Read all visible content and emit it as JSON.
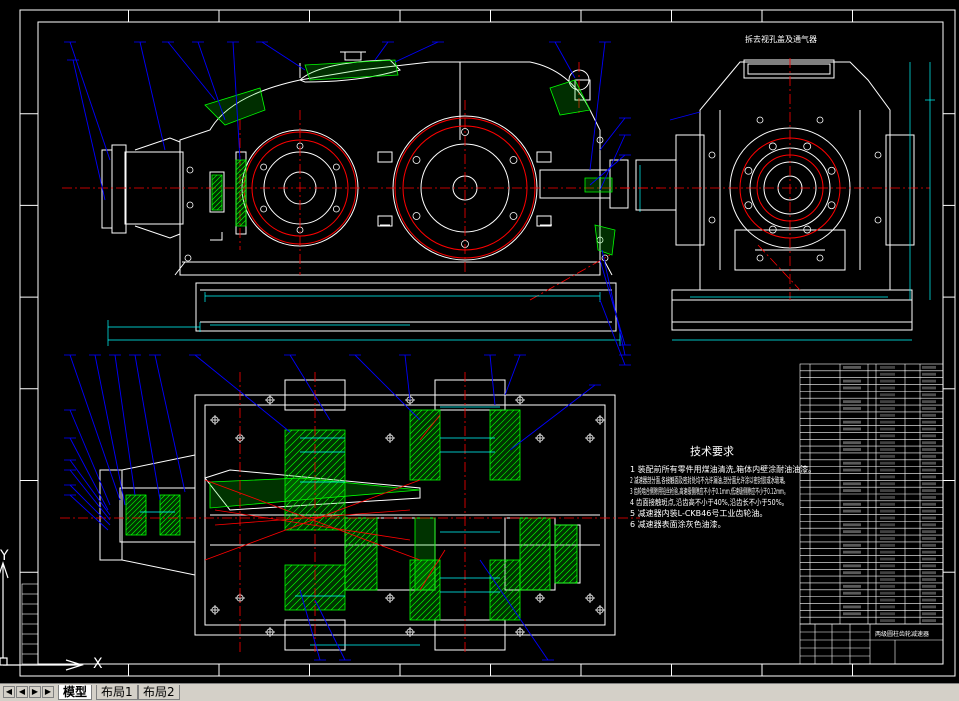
{
  "workspace": {
    "background": "#000000",
    "colors": {
      "frame": "#ffffff",
      "outline": "#ffffff",
      "center": "#ff0000",
      "gear": "#ff0000",
      "dimension": "#00ffff",
      "leader": "#0000ff",
      "hatch": "#00ff00",
      "text": "#ffffff",
      "label": "#ffff00"
    }
  },
  "view_titles": {
    "side_view": "拆去视孔盖及通气器"
  },
  "tech_req": {
    "title": "技术要求",
    "items": [
      "1  装配前所有零件用煤油清洗,箱体内壁涂耐油油漆。",
      "2  减速器剖分面,各接触面及密封处均不允许漏油,剖分面允许涂以密封胶或水玻璃。",
      "3  齿轮啮合侧隙用铅丝检验,高速级侧隙应不小于0.1mm,低速级侧隙应不小于0.12mm。",
      "4  齿面接触斑点,沿齿高不小于40%,沿齿长不小于50%。",
      "5  减速器内装L-CKB46号工业齿轮油。",
      "6  减速器表面涂灰色油漆。"
    ]
  },
  "title_block": {
    "drawing_title": "两级圆柱齿轮减速器",
    "rows": 38
  },
  "ucs": {
    "x_label": "X",
    "y_label": "Y"
  },
  "tabs": {
    "items": [
      {
        "label": "模型",
        "active": true
      },
      {
        "label": "布局1",
        "active": false
      },
      {
        "label": "布局2",
        "active": false
      }
    ],
    "nav": [
      "◀",
      "◀",
      "▶",
      "▶"
    ]
  }
}
